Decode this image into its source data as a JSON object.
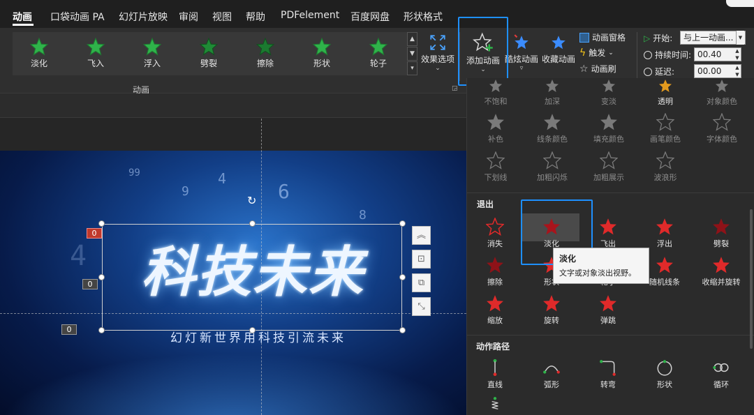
{
  "tabs": [
    {
      "label": "动画",
      "active": true
    },
    {
      "label": "口袋动画 PA"
    },
    {
      "label": "幻灯片放映"
    },
    {
      "label": "审阅"
    },
    {
      "label": "视图"
    },
    {
      "label": "帮助"
    },
    {
      "label": "PDFelement"
    },
    {
      "label": "百度网盘"
    },
    {
      "label": "形状格式"
    }
  ],
  "ribbon": {
    "gallery": [
      "淡化",
      "飞入",
      "浮入",
      "劈裂",
      "擦除",
      "形状",
      "轮子"
    ],
    "group_label": "动画",
    "effect_options": "效果选项",
    "add_animation": "添加动画",
    "fancy_animation": "酷炫动画",
    "favorite_animation": "收藏动画",
    "animation_pane": "动画窗格",
    "trigger": "触发",
    "animation_painter": "动画刷",
    "start_label": "开始:",
    "start_value": "与上一动画...",
    "duration_label": "持续时间:",
    "duration_value": "00.40",
    "delay_label": "延迟:",
    "delay_value": "00.00"
  },
  "slide": {
    "title": "科技未来",
    "subtitle": "幻灯新世界用科技引流未来",
    "digits": [
      "99",
      "4",
      "9",
      "6",
      "8",
      "4"
    ],
    "badges": [
      "0",
      "0",
      "0"
    ]
  },
  "panel": {
    "emphasis_row1": [
      "不饱和",
      "加深",
      "变淡",
      "透明",
      "对象颜色"
    ],
    "emphasis_row2": [
      "补色",
      "线条颜色",
      "填充颜色",
      "画笔颜色",
      "字体颜色"
    ],
    "emphasis_row3": [
      "下划线",
      "加粗闪烁",
      "加粗展示",
      "波浪形"
    ],
    "exit_title": "退出",
    "exit_row1": [
      "消失",
      "淡化",
      "飞出",
      "浮出",
      "劈裂"
    ],
    "exit_row2": [
      "擦除",
      "形状",
      "轮子",
      "随机线条",
      "收缩并旋转"
    ],
    "exit_row3": [
      "缩放",
      "旋转",
      "弹跳"
    ],
    "path_title": "动作路径",
    "path_row1": [
      "直线",
      "弧形",
      "转弯",
      "形状",
      "循环"
    ]
  },
  "tooltip": {
    "title": "淡化",
    "desc": "文字或对象淡出视野。"
  },
  "colors": {
    "green_star": "#2fb34a",
    "red_star": "#e02a2a",
    "gray_star": "#8f8f8f",
    "highlight": "#1e90ff"
  }
}
